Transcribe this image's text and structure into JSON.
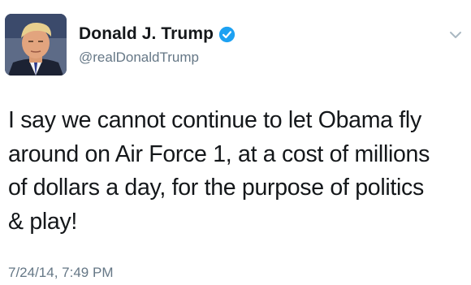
{
  "tweet": {
    "author": {
      "display_name": "Donald J. Trump",
      "handle": "@realDonaldTrump",
      "verified": true,
      "avatar_icon": "profile-photo"
    },
    "text": "I say we cannot continue to let Obama fly\naround on Air Force 1, at a cost of millions\nof dollars a day, for the purpose of politics\n& play!",
    "timestamp": "7/24/14, 7:49 PM",
    "menu_icon": "chevron-down-icon"
  },
  "colors": {
    "verified_badge": "#1da1f2",
    "secondary_text": "#657786",
    "primary_text": "#14171a",
    "background": "#ffffff"
  }
}
